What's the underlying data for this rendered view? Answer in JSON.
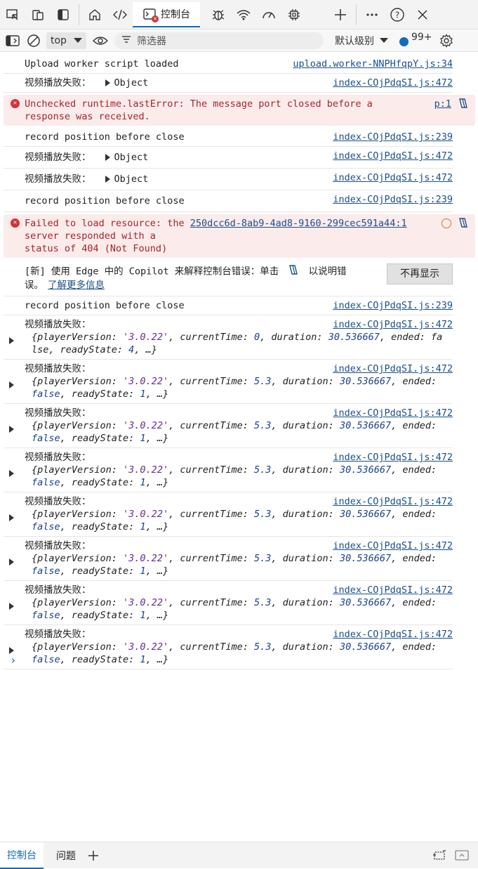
{
  "toolbar": {
    "active_tab_label": "控制台"
  },
  "filterbar": {
    "context": "top",
    "filter_placeholder": "筛选器",
    "level_label": "默认级别",
    "badge_count": "99+"
  },
  "messages": [
    {
      "type": "log",
      "text": "Upload worker script loaded",
      "source": "upload.worker-NNPHfqpY.js:34"
    },
    {
      "type": "log",
      "label": "视频播放失败：",
      "object": "Object",
      "source": "index-COjPdqSI.js:472"
    },
    {
      "type": "error",
      "text": "Unchecked runtime.lastError: The message port closed before a response was received.",
      "source": "p:1"
    },
    {
      "type": "log",
      "text": "record position before close",
      "source": "index-COjPdqSI.js:239"
    },
    {
      "type": "log",
      "label": "视频播放失败：",
      "object": "Object",
      "source": "index-COjPdqSI.js:472"
    },
    {
      "type": "log",
      "label": "视频播放失败：",
      "object": "Object",
      "source": "index-COjPdqSI.js:472"
    },
    {
      "type": "log",
      "text": "record position before close",
      "source": "index-COjPdqSI.js:239"
    },
    {
      "type": "error",
      "text_prefix": "Failed to load resource: the",
      "link": "250dcc6d-8ab9-4ad8-9160-299cec591a44:1",
      "line2": "server responded with a",
      "line3": "status of 404 (Not Found)"
    }
  ],
  "copilot": {
    "text1": "[新] 使用 Edge 中的 Copilot 来解释控制台错误：单击",
    "text2": "以说明错",
    "text3": "误。",
    "link": "了解更多信息",
    "dismiss": "不再显示"
  },
  "messages2": [
    {
      "type": "log",
      "text": "record position before close",
      "source": "index-COjPdqSI.js:239"
    }
  ],
  "objects": [
    {
      "label": "视频播放失败：",
      "source": "index-COjPdqSI.js:472",
      "l1": "{playerVersion: '3.0.22', currentTime: 0, duration: 30.536667, ended: fa",
      "l2": "lse, readyState: 4, …}"
    },
    {
      "label": "视频播放失败：",
      "source": "index-COjPdqSI.js:472",
      "l1": "{playerVersion: '3.0.22', currentTime: 5.3, duration: 30.536667, ended:",
      "l2": "false, readyState: 1, …}"
    },
    {
      "label": "视频播放失败：",
      "source": "index-COjPdqSI.js:472",
      "l1": "{playerVersion: '3.0.22', currentTime: 5.3, duration: 30.536667, ended:",
      "l2": "false, readyState: 1, …}"
    },
    {
      "label": "视频播放失败：",
      "source": "index-COjPdqSI.js:472",
      "l1": "{playerVersion: '3.0.22', currentTime: 5.3, duration: 30.536667, ended:",
      "l2": "false, readyState: 1, …}"
    },
    {
      "label": "视频播放失败：",
      "source": "index-COjPdqSI.js:472",
      "l1": "{playerVersion: '3.0.22', currentTime: 5.3, duration: 30.536667, ended:",
      "l2": "false, readyState: 1, …}"
    },
    {
      "label": "视频播放失败：",
      "source": "index-COjPdqSI.js:472",
      "l1": "{playerVersion: '3.0.22', currentTime: 5.3, duration: 30.536667, ended:",
      "l2": "false, readyState: 1, …}"
    },
    {
      "label": "视频播放失败：",
      "source": "index-COjPdqSI.js:472",
      "l1": "{playerVersion: '3.0.22', currentTime: 5.3, duration: 30.536667, ended:",
      "l2": "false, readyState: 1, …}"
    },
    {
      "label": "视频播放失败：",
      "source": "index-COjPdqSI.js:472",
      "l1": "{playerVersion: '3.0.22', currentTime: 5.3, duration: 30.536667, ended:",
      "l2": "false, readyState: 1, …}"
    }
  ],
  "bottom": {
    "tab_console": "控制台",
    "tab_issues": "问题"
  },
  "colors": {
    "accent": "#0f6cbd",
    "error": "#d13438",
    "error_bg": "#fcebeb"
  }
}
